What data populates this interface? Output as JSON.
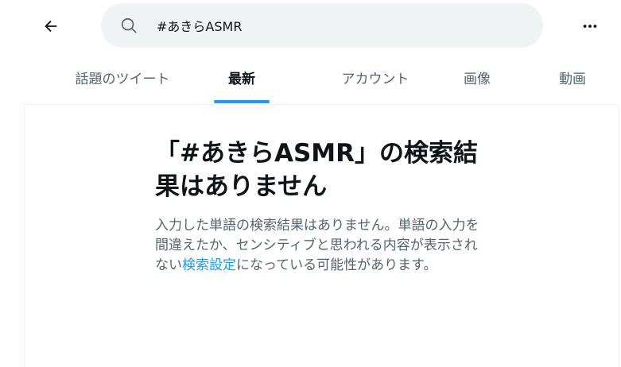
{
  "header": {
    "search_value": "#あきらASMR"
  },
  "tabs": [
    {
      "label": "話題のツイート"
    },
    {
      "label": "最新"
    },
    {
      "label": "アカウント"
    },
    {
      "label": "画像"
    },
    {
      "label": "動画"
    }
  ],
  "empty_state": {
    "title": "「#あきらASMR」の検索結果はありません",
    "desc_before": "入力した単語の検索結果はありません。単語の入力を間違えたか、センシティブと思われる内容が表示されない",
    "desc_link": "検索設定",
    "desc_after": "になっている可能性があります。"
  },
  "colors": {
    "accent": "#1d9bf0",
    "text_primary": "#0f1419",
    "text_secondary": "#536471",
    "search_bg": "#eff3f4"
  }
}
